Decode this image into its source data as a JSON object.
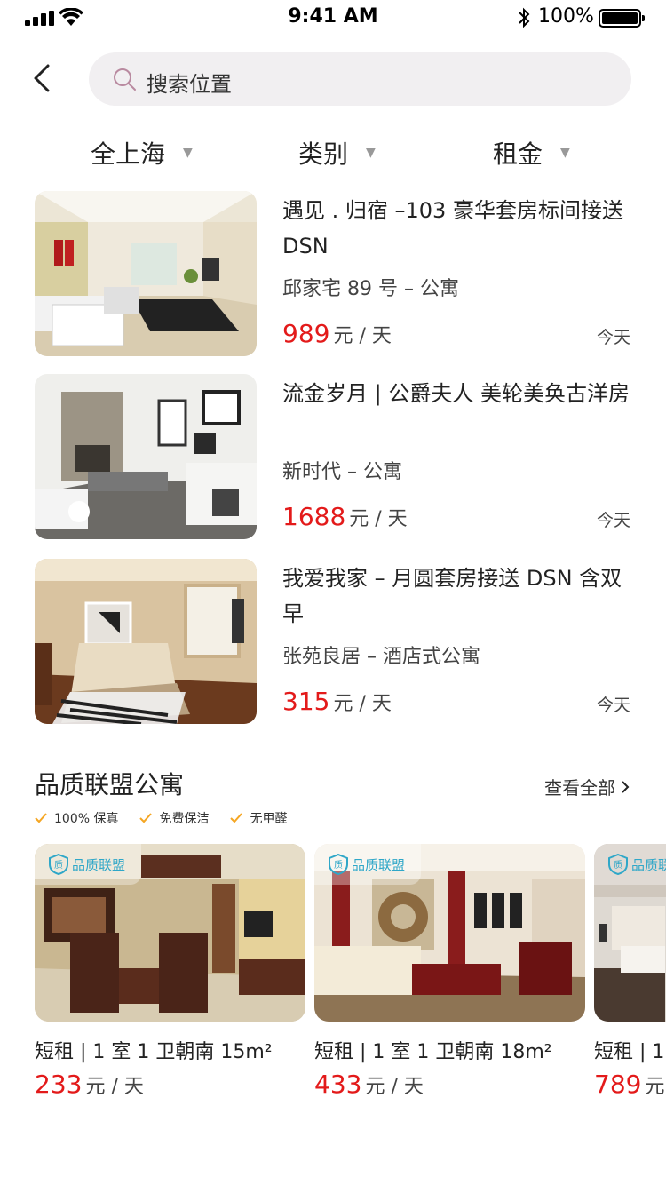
{
  "status_bar": {
    "time": "9:41 AM",
    "battery": "100%"
  },
  "search": {
    "placeholder": "搜索位置"
  },
  "filters": [
    {
      "label": "全上海"
    },
    {
      "label": "类别"
    },
    {
      "label": "租金"
    }
  ],
  "listings": [
    {
      "title": "遇见 . 归宿 –103 豪华套房标间接送 DSN",
      "address": "邱家宅 89 号 – 公寓",
      "price": "989",
      "unit": "元 / 天",
      "date": "今天"
    },
    {
      "title": "流金岁月 | 公爵夫人 美轮美奂古洋房",
      "address": "新时代 – 公寓",
      "price": "1688",
      "unit": "元 / 天",
      "date": "今天"
    },
    {
      "title": "我爱我家 – 月圆套房接送 DSN 含双早",
      "address": "张苑良居 – 酒店式公寓",
      "price": "315",
      "unit": "元 / 天",
      "date": "今天"
    }
  ],
  "section": {
    "title": "品质联盟公寓",
    "view_all": "查看全部",
    "features": [
      "100% 保真",
      "免费保洁",
      "无甲醛"
    ]
  },
  "cards": [
    {
      "badge": "品质联盟",
      "title": "短租 | 1 室 1 卫朝南 15m²",
      "price": "233",
      "unit": "元 / 天"
    },
    {
      "badge": "品质联盟",
      "title": "短租 | 1 室 1 卫朝南 18m²",
      "price": "433",
      "unit": "元 / 天"
    },
    {
      "badge": "品质联盟",
      "title": "短租 | 1",
      "price": "789",
      "unit": "元"
    }
  ],
  "colors": {
    "price": "#e31a1a",
    "badge": "#2fa7c8",
    "check": "#f5a623",
    "search_bg": "#f1eff1"
  }
}
